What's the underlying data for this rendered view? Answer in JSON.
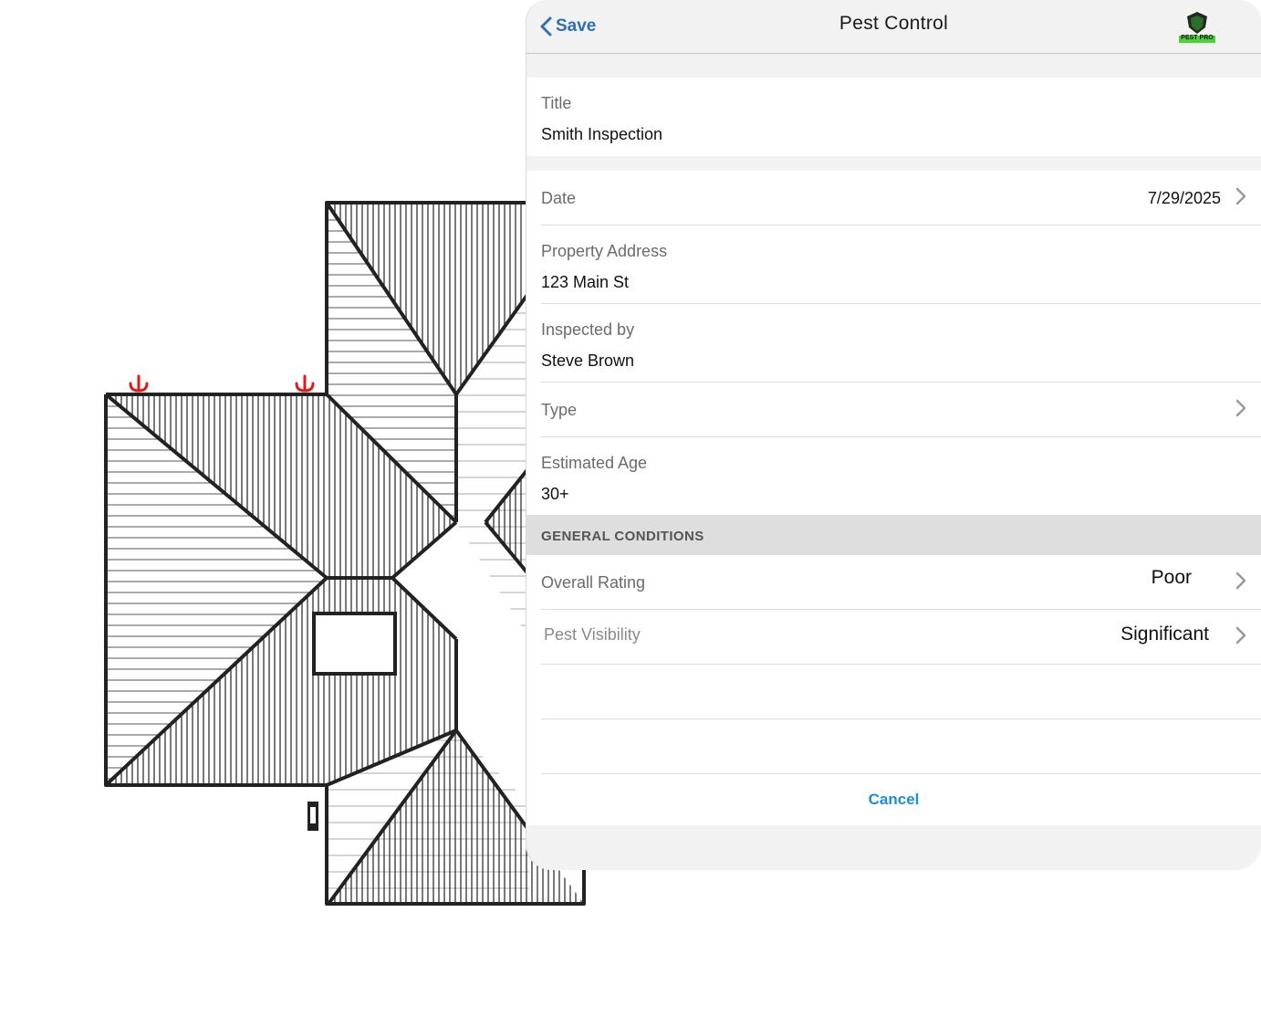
{
  "navbar": {
    "back_label": "Save",
    "title": "Pest Control",
    "logo_text": "PEST PRO"
  },
  "form": {
    "title": {
      "label": "Title",
      "value": "Smith Inspection"
    },
    "date": {
      "label": "Date",
      "value": "7/29/2025"
    },
    "property_address": {
      "label": "Property Address",
      "value": "123 Main St"
    },
    "inspected_by": {
      "label": "Inspected by",
      "value": "Steve Brown"
    },
    "type": {
      "label": "Type",
      "value": ""
    },
    "estimated_age": {
      "label": "Estimated Age",
      "value": "30+"
    }
  },
  "general_conditions": {
    "header": "GENERAL CONDITIONS",
    "overall_rating": {
      "label": "Overall Rating",
      "value": "Poor"
    },
    "pest_visibility": {
      "label": "Pest Visibility",
      "value": "Significant"
    }
  },
  "cancel_label": "Cancel",
  "colors": {
    "accent_blue": "#2f6fb6",
    "cancel_blue": "#1a8fd8",
    "marker_red": "#e01a1a",
    "logo_green": "#4cd137"
  }
}
